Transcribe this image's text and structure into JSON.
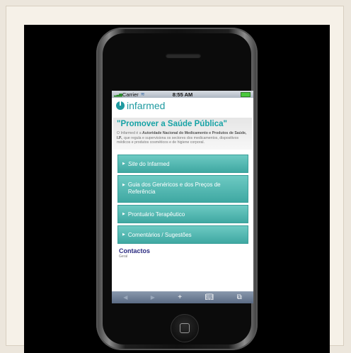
{
  "status_bar": {
    "carrier": "Carrier",
    "time": "8:55 AM",
    "signal_icon": "signal-bars-icon",
    "wifi_icon": "wifi-icon",
    "battery_icon": "battery-icon"
  },
  "logo": {
    "text": "infarmed",
    "icon": "infarmed-logo-icon"
  },
  "hero": {
    "title": "\"Promover a Saúde Pública\"",
    "text_prefix": "O Infarmed é a ",
    "text_bold": "Autoridade Nacional do Medicamento e Produtos de Saúde, I.P.",
    "text_suffix": ", que regula e supervisiona os sectores dos medicamentos, dispositivos médicos e produtos cosméticos e de higiene corporal."
  },
  "menu": {
    "site_italic": "Site",
    "site_rest": " do Infarmed",
    "guia": "Guia dos Genéricos e dos Preços de Referência",
    "prontuario": "Prontuário Terapêutico",
    "comentarios": "Comentários / Sugestões"
  },
  "contacts": {
    "heading": "Contactos",
    "sub": "Geral"
  },
  "toolbar": {
    "back": "◀",
    "forward": "▶",
    "add": "+",
    "bookmarks": "ꟷ",
    "pages": "⧉"
  },
  "colors": {
    "accent": "#1f9aa0",
    "button": "#4fb7b0",
    "contacts": "#2a2a80"
  }
}
